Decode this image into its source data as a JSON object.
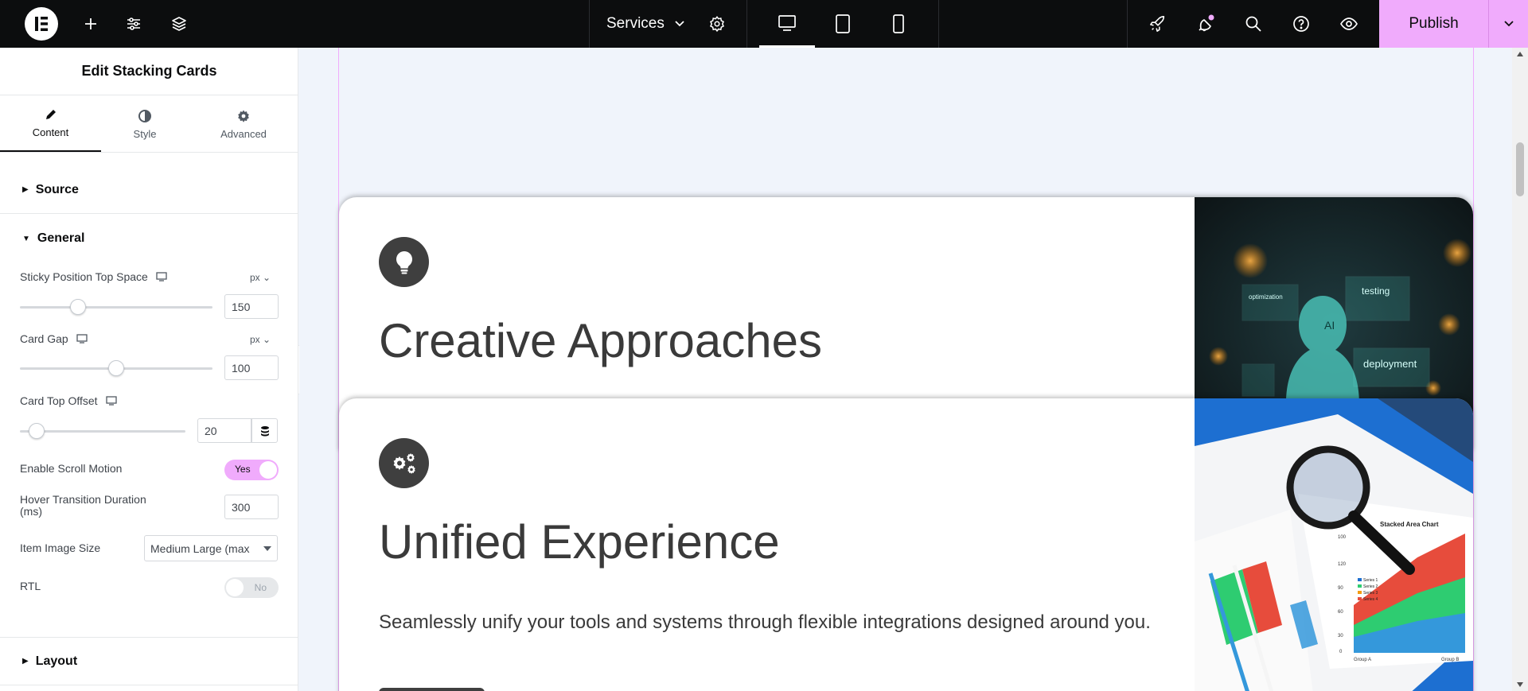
{
  "topbar": {
    "page_name": "Services",
    "publish_label": "Publish",
    "icons": [
      "elementor-logo-icon",
      "add-icon",
      "site-settings-icon",
      "structure-icon",
      "page-settings-icon",
      "desktop-icon",
      "tablet-icon",
      "mobile-icon",
      "launchpad-icon",
      "notifications-icon",
      "search-icon",
      "help-icon",
      "preview-icon",
      "chevron-down-icon"
    ],
    "notification_dot_color": "#f0abfc"
  },
  "panel": {
    "title": "Edit Stacking Cards",
    "tabs": [
      {
        "label": "Content",
        "icon": "pencil-icon"
      },
      {
        "label": "Style",
        "icon": "half-circle-icon"
      },
      {
        "label": "Advanced",
        "icon": "gear-icon"
      }
    ],
    "sections": {
      "source": "Source",
      "general": "General",
      "layout": "Layout"
    },
    "controls": {
      "sticky_top": {
        "label": "Sticky Position Top Space",
        "unit": "px",
        "value": "150",
        "slider_fraction": 0.3
      },
      "card_gap": {
        "label": "Card Gap",
        "unit": "px",
        "value": "100",
        "slider_fraction": 0.5
      },
      "card_top_offset": {
        "label": "Card Top Offset",
        "value": "20",
        "slider_fraction": 0.1
      },
      "scroll_motion": {
        "label": "Enable Scroll Motion",
        "value": "Yes"
      },
      "hover_duration": {
        "label_line1": "Hover Transition Duration",
        "label_line2": "(ms)",
        "value": "300"
      },
      "image_size": {
        "label": "Item Image Size",
        "value": "Medium Large (max"
      },
      "rtl": {
        "label": "RTL",
        "value": "No"
      }
    },
    "accent_color": "#f0abfc"
  },
  "canvas": {
    "cards": [
      {
        "title": "Creative Approaches",
        "icon": "lightbulb-icon",
        "image": "ai-hologram-image"
      },
      {
        "title": "Unified Experience",
        "icon": "cogs-icon",
        "image": "magnifier-chart-image",
        "description": "Seamlessly unify your tools and systems through flexible integrations designed around you."
      }
    ],
    "image1_labels": [
      "testing",
      "deployment",
      "AI",
      "optimization"
    ],
    "image2_labels": {
      "chart_title": "Stacked Area Chart",
      "y_ticks": [
        "100",
        "120",
        "90",
        "60",
        "30",
        "0"
      ],
      "x_labels": [
        "Group A",
        "Group B"
      ],
      "legend": [
        "Series 1",
        "Series 2",
        "Series 3",
        "Series 4"
      ]
    }
  }
}
